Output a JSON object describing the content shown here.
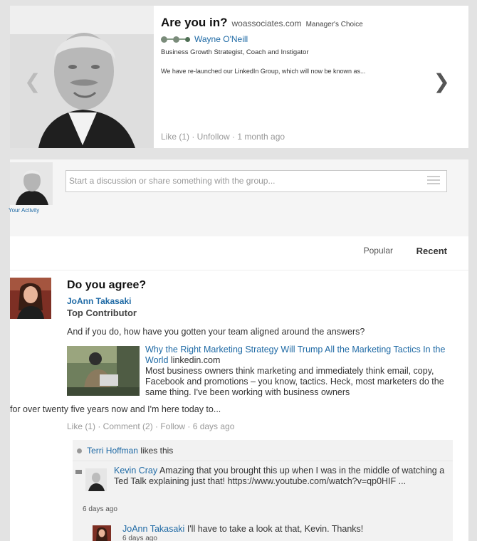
{
  "featured": {
    "title": "Are you in?",
    "site": "woassociates.com",
    "choice": "Manager's Choice",
    "author": "Wayne O'Neill",
    "headline": "Business Growth Strategist, Coach and Instigator",
    "teaser": "We have re-launched our LinkedIn Group, which will now be known as...",
    "meta": "Like (1) · Unfollow · 1 month ago",
    "prev_icon": "chevron-left-icon",
    "next_icon": "chevron-right-icon"
  },
  "composer": {
    "placeholder": "Start a discussion or share something with the group...",
    "activity_label": "Your Activity"
  },
  "tabs": {
    "popular": "Popular",
    "recent": "Recent"
  },
  "post": {
    "title": "Do you agree?",
    "author": "JoAnn Takasaki",
    "badge": "Top Contributor",
    "question": "And if you do, how have you gotten your team aligned around the answers?",
    "link_title": "Why the Right Marketing Strategy Will Trump All the Marketing Tactics In the World",
    "link_source": "linkedin.com",
    "summary": "Most business owners think marketing and immediately think email, copy, Facebook and promotions – you know, tactics. Heck, most marketers do the same thing. I've been working with business owners",
    "summary_tail": "for over twenty five years now and I'm here today to...",
    "actions": "Like (1) · Comment (2) · Follow · 6 days ago"
  },
  "social": {
    "liker": "Terri Hoffman",
    "likes_suffix": "likes this",
    "comment": {
      "author": "Kevin Cray",
      "text": "Amazing that you brought this up when I was in the middle of watching a Ted Talk explaining just that! https://www.youtube.com/watch?v=qp0HIF ...",
      "time": "6 days ago"
    },
    "reply": {
      "author": "JoAnn Takasaki",
      "text": "I'll have to take a look at that, Kevin. Thanks!",
      "time": "6 days ago"
    }
  }
}
